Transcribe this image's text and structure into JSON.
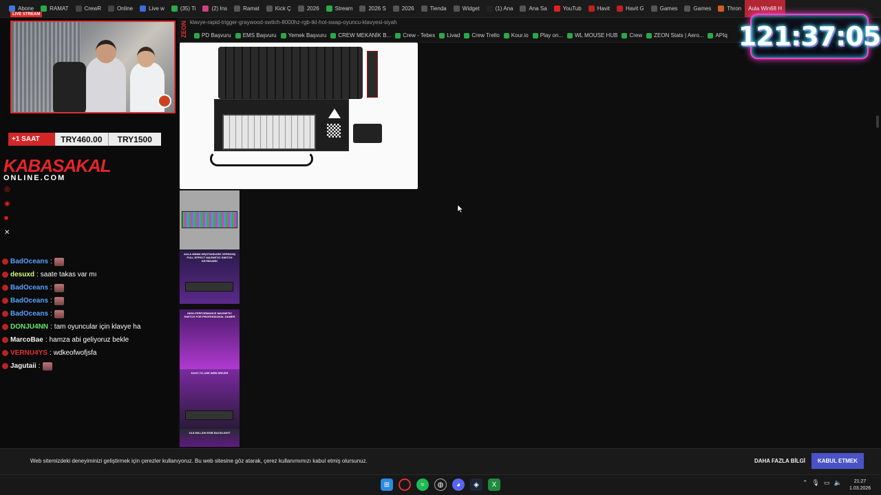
{
  "tabs": [
    {
      "label": "Abone",
      "color": "#3b7bdc"
    },
    {
      "label": "RAMAT",
      "color": "#2aa84a"
    },
    {
      "label": "CrewR",
      "color": "#444"
    },
    {
      "label": "Online",
      "color": "#444"
    },
    {
      "label": "Live w",
      "color": "#3b6bdc"
    },
    {
      "label": "(35) Ti",
      "color": "#2aa84a"
    },
    {
      "label": "(2) Ins",
      "color": "#d04080"
    },
    {
      "label": "Ramat",
      "color": "#555"
    },
    {
      "label": "Kick Ç",
      "color": "#555"
    },
    {
      "label": "2026",
      "color": "#555"
    },
    {
      "label": "Stream",
      "color": "#2aa84a"
    },
    {
      "label": "2026 S",
      "color": "#555"
    },
    {
      "label": "2026",
      "color": "#555"
    },
    {
      "label": "Tienda",
      "color": "#555"
    },
    {
      "label": "Widget",
      "color": "#555"
    },
    {
      "label": "(1) Ana",
      "color": "#222"
    },
    {
      "label": "Ana Sa",
      "color": "#555"
    },
    {
      "label": "YouTub",
      "color": "#e02020"
    },
    {
      "label": "Havit",
      "color": "#c02020"
    },
    {
      "label": "Havit G",
      "color": "#c02020"
    },
    {
      "label": "Games",
      "color": "#555"
    },
    {
      "label": "Games",
      "color": "#555"
    },
    {
      "label": "Thron",
      "color": "#d06020"
    }
  ],
  "active_tab": {
    "label": "Aula Win68 H"
  },
  "url": "klavye-rapid-trigger-graywood-swtich-8000hz-rgb-tkl-hot-swap-oyuncu-klavyesi-siyah",
  "bookmarks": [
    "PD Başvuru",
    "EMS Başvuru",
    "Yemek Başvuru",
    "CREW MEKANİK B...",
    "Crew - Tebex",
    "Livad",
    "Crew Trello",
    "Kour.io",
    "Play on...",
    "WL MOUSE HUB",
    "Crew",
    "ZEON Stats | Aero...",
    "APIq"
  ],
  "zeon_label": "ZEON",
  "overlay": {
    "live_badge": "LIVE STREAM",
    "saat": "+1 SAAT",
    "price1": "TRY460.00",
    "price2": "TRY1500",
    "brand_top": "KABASAKAL",
    "brand_bottom": "ONLINE.COM"
  },
  "chat": [
    {
      "name": "BadOceans",
      "color": "#5aa0ff",
      "text": "",
      "emote": true
    },
    {
      "name": "desuxd",
      "color": "#d4ff7a",
      "text": "saate takas var mı",
      "emote": false
    },
    {
      "name": "BadOceans",
      "color": "#5aa0ff",
      "text": "",
      "emote": true
    },
    {
      "name": "BadOceans",
      "color": "#5aa0ff",
      "text": "",
      "emote": true
    },
    {
      "name": "BadOceans",
      "color": "#5aa0ff",
      "text": "",
      "emote": true
    },
    {
      "name": "DONJU4NN",
      "color": "#6be66b",
      "text": "tam oyuncular için klavye ha",
      "emote": false
    },
    {
      "name": "MarcoBae",
      "color": "#f0f0f0",
      "text": "hamza abi geliyoruz bekle",
      "emote": false
    },
    {
      "name": "VERNU4YS",
      "color": "#e03030",
      "text": "wdkeofwofjsfa",
      "emote": false
    },
    {
      "name": "Jagutaii",
      "color": "#f0f0f0",
      "text": "",
      "emote": true
    }
  ],
  "thumbnails": [
    {
      "caption": ""
    },
    {
      "caption": "AULA WIN68 HE(STANDARD VERSION) FULL EFFECT MAGNETIC SWITCH KEYBOARD"
    },
    {
      "caption": "HIGH-PERFORMANCE MAGNETIC SWITCH FOR PROFESSIONAL GAMER"
    },
    {
      "caption": "EASY-TO-USE WEB DRIVER"
    },
    {
      "caption": "16.8 MILLION RGB BACKLIGHT"
    }
  ],
  "timer": "121:37:05",
  "cookie": {
    "text": "Web sitemizdeki deneyiminizi geliştirmek için çerezler kullanıyoruz. Bu web sitesine göz atarak, çerez kullanımımızı kabul etmiş olursunuz.",
    "more_label": "DAHA FAZLA BİLGİ",
    "accept_label": "KABUL ETMEK",
    "accent": "#4a52c8"
  },
  "taskbar": {
    "time": "21:27",
    "date": "1.03.2026"
  }
}
